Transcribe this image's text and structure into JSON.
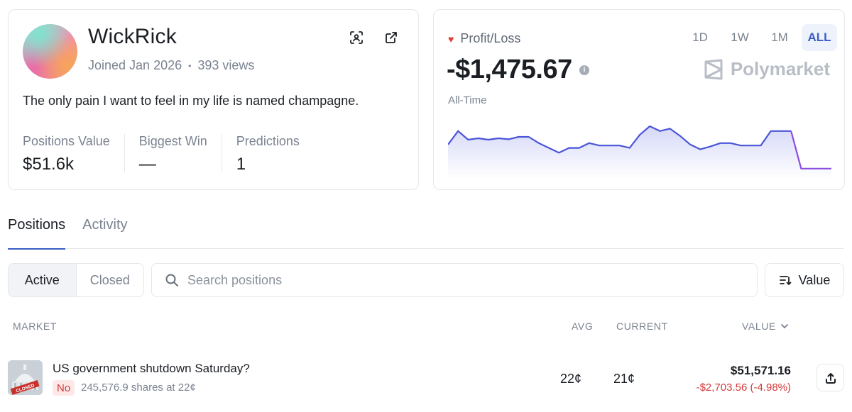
{
  "profile": {
    "username": "WickRick",
    "joined": "Joined Jan 2026",
    "views": "393 views",
    "bio": "The only pain I want to feel in my life is named champagne.",
    "stats": [
      {
        "label": "Positions Value",
        "value": "$51.6k"
      },
      {
        "label": "Biggest Win",
        "value": "—"
      },
      {
        "label": "Predictions",
        "value": "1"
      }
    ]
  },
  "pnl": {
    "label": "Profit/Loss",
    "amount": "-$1,475.67",
    "period": "All-Time",
    "ranges": [
      "1D",
      "1W",
      "1M",
      "ALL"
    ],
    "active_range": "ALL",
    "brand": "Polymarket",
    "colors": {
      "line": "#4a55d9",
      "line_end": "#8b4fe0",
      "heart": "#e0403a"
    }
  },
  "chart_data": {
    "type": "area",
    "series": [
      {
        "values": [
          0.62,
          0.9,
          0.72,
          0.75,
          0.72,
          0.75,
          0.73,
          0.78,
          0.78,
          0.65,
          0.55,
          0.45,
          0.55,
          0.55,
          0.65,
          0.6,
          0.6,
          0.6,
          0.55,
          0.82,
          1.0,
          0.9,
          0.95,
          0.8,
          0.62,
          0.52,
          0.58,
          0.65,
          0.65,
          0.6,
          0.6,
          0.6,
          0.9,
          0.9,
          0.9,
          0.12,
          0.12,
          0.12,
          0.12
        ]
      }
    ]
  },
  "tabs": [
    {
      "label": "Positions",
      "active": true
    },
    {
      "label": "Activity",
      "active": false
    }
  ],
  "filters": {
    "segments": [
      "Active",
      "Closed"
    ],
    "active_segment": "Active",
    "search_placeholder": "Search positions",
    "sort_label": "Value"
  },
  "table": {
    "headers": {
      "market": "MARKET",
      "avg": "AVG",
      "current": "CURRENT",
      "value": "VALUE"
    },
    "rows": [
      {
        "market": "US government shutdown Saturday?",
        "outcome": "No",
        "shares": "245,576.9 shares at 22¢",
        "avg": "22¢",
        "current": "21¢",
        "value": "$51,571.16",
        "change": "-$2,703.56 (-4.98%)",
        "thumb_text": "CLOSED"
      }
    ]
  }
}
